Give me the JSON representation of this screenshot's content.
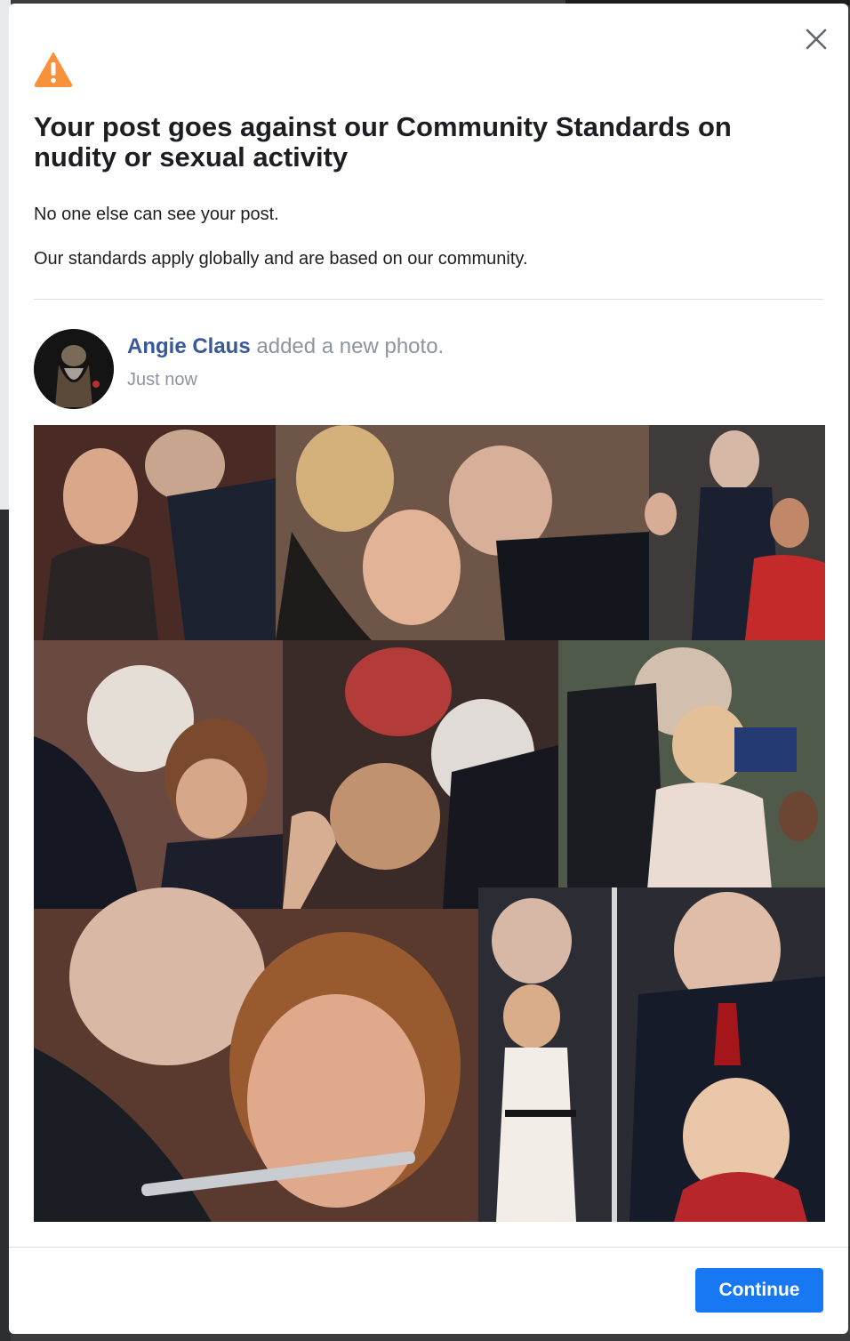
{
  "dialog": {
    "title": "Your post goes against our Community Standards on nudity or sexual activity",
    "line1": "No one else can see your post.",
    "line2": "Our standards apply globally and are based on our community.",
    "continue_label": "Continue"
  },
  "post": {
    "author": "Angie Claus",
    "action": " added a new photo.",
    "timestamp": "Just now"
  },
  "icons": {
    "warning": "warning-icon",
    "close": "close-icon"
  },
  "colors": {
    "accent": "#1877f2",
    "author_link": "#385898",
    "warning": "#f7923b",
    "muted_text": "#8d949e"
  }
}
